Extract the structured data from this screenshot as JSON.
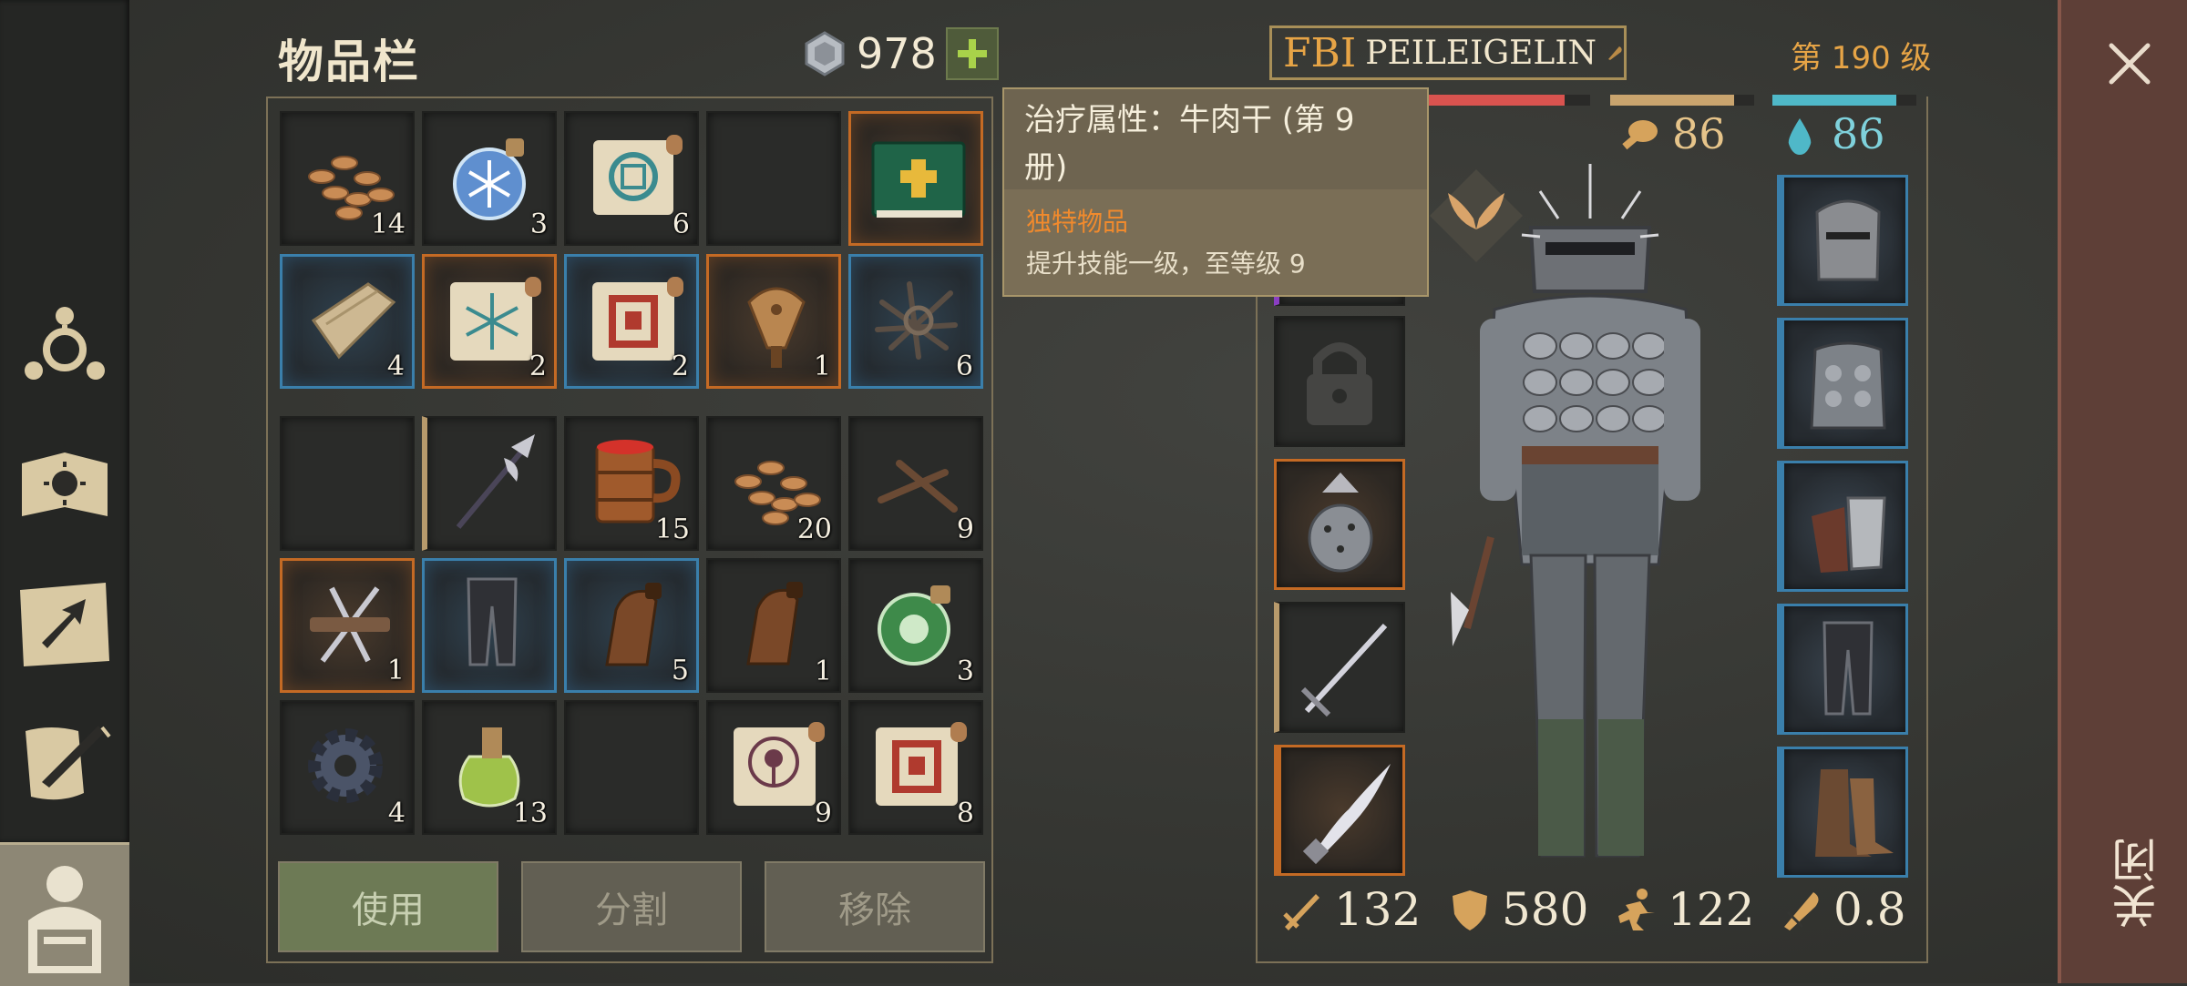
{
  "inventory": {
    "title": "物品栏",
    "currency": "978",
    "slots_top": [
      {
        "icon": "wheat-seeds-icon",
        "count": "14",
        "frame": ""
      },
      {
        "icon": "frost-potion-icon",
        "count": "3",
        "frame": ""
      },
      {
        "icon": "blue-rune-scroll-icon",
        "count": "6",
        "frame": ""
      },
      {
        "icon": "",
        "count": "",
        "frame": ""
      },
      {
        "icon": "green-book-icon",
        "count": "",
        "frame": "orange"
      },
      {
        "icon": "wood-plank-icon",
        "count": "4",
        "frame": "blue"
      },
      {
        "icon": "frost-rune-scroll-icon",
        "count": "2",
        "frame": "orange"
      },
      {
        "icon": "red-rune-scroll-icon",
        "count": "2",
        "frame": "blue"
      },
      {
        "icon": "bellows-icon",
        "count": "1",
        "frame": "orange"
      },
      {
        "icon": "iron-nails-icon",
        "count": "6",
        "frame": "blue"
      }
    ],
    "slots_bottom": [
      {
        "icon": "",
        "count": "",
        "frame": ""
      },
      {
        "icon": "halberd-icon",
        "count": "",
        "frame": "tan"
      },
      {
        "icon": "beer-mug-icon",
        "count": "15",
        "frame": ""
      },
      {
        "icon": "wheat-seeds-icon",
        "count": "20",
        "frame": ""
      },
      {
        "icon": "nails-icon",
        "count": "9",
        "frame": ""
      },
      {
        "icon": "spiked-trap-icon",
        "count": "1",
        "frame": "orange"
      },
      {
        "icon": "chain-leggings-icon",
        "count": "",
        "frame": "blue"
      },
      {
        "icon": "leather-flask-icon",
        "count": "5",
        "frame": "blue"
      },
      {
        "icon": "leather-flask-icon",
        "count": "1",
        "frame": ""
      },
      {
        "icon": "green-potion-icon",
        "count": "3",
        "frame": ""
      },
      {
        "icon": "gear-icon",
        "count": "4",
        "frame": ""
      },
      {
        "icon": "yellow-potion-icon",
        "count": "13",
        "frame": ""
      },
      {
        "icon": "",
        "count": "",
        "frame": ""
      },
      {
        "icon": "skull-scroll-icon",
        "count": "9",
        "frame": ""
      },
      {
        "icon": "red-rune-scroll-icon",
        "count": "8",
        "frame": ""
      }
    ],
    "buttons": {
      "use": "使用",
      "split": "分割",
      "remove": "移除"
    }
  },
  "tooltip": {
    "title": "治疗属性：牛肉干 (第 9 册)",
    "kind": "独特物品",
    "desc": "提升技能一级，至等级 9"
  },
  "character": {
    "tag": "FBI",
    "name": "PEILEIGELIN",
    "level": "第 190 级",
    "food": "86",
    "water": "86",
    "health_fraction": 0.85,
    "food_fraction": 0.86,
    "water_fraction": 0.86,
    "stats": {
      "attack": "132",
      "armor": "580",
      "speed": "122",
      "crit": "0.8"
    }
  },
  "close": {
    "label": "关闭"
  },
  "colors": {
    "orange_frame": "#c46a24",
    "blue_frame": "#3a7fab",
    "accent": "#e6a446",
    "water": "#4fb8c8",
    "health": "#d9534f"
  }
}
